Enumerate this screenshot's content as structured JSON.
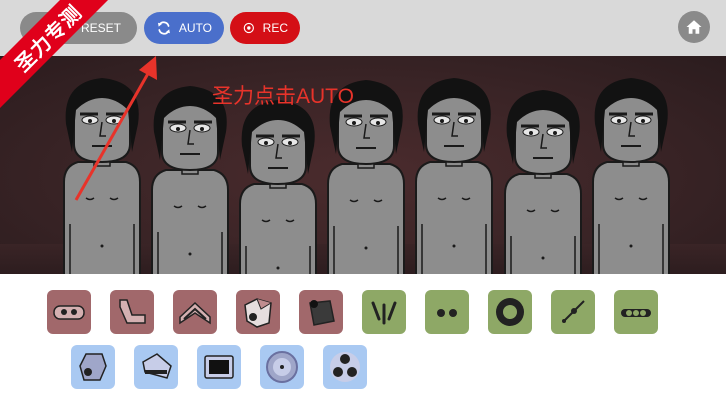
{
  "toolbar": {
    "reset_label": "RESET",
    "auto_label": "AUTO",
    "rec_label": "REC",
    "icons": {
      "reset": "reset-icon",
      "auto": "refresh-icon",
      "rec": "record-icon",
      "home": "home-icon"
    }
  },
  "overlay": {
    "ribbon_text": "圣力专测",
    "annotation_text": "圣力点击AUTO"
  },
  "stage": {
    "character_count": 7
  },
  "palette": {
    "row1": [
      {
        "group": "beats",
        "color": "#a1686b",
        "icon": "beat-pill-icon"
      },
      {
        "group": "beats",
        "color": "#a1686b",
        "icon": "beat-bent-pipe-icon"
      },
      {
        "group": "beats",
        "color": "#a1686b",
        "icon": "beat-chevron-icon"
      },
      {
        "group": "beats",
        "color": "#a1686b",
        "icon": "beat-shield-icon"
      },
      {
        "group": "beats",
        "color": "#a1686b",
        "icon": "beat-cube-icon"
      },
      {
        "group": "effects",
        "color": "#8ea866",
        "icon": "effect-tree-icon"
      },
      {
        "group": "effects",
        "color": "#8ea866",
        "icon": "effect-eyes-icon"
      },
      {
        "group": "effects",
        "color": "#8ea866",
        "icon": "effect-ring-icon"
      },
      {
        "group": "effects",
        "color": "#8ea866",
        "icon": "effect-antenna-icon"
      },
      {
        "group": "effects",
        "color": "#8ea866",
        "icon": "effect-dots-icon"
      }
    ],
    "row2": [
      {
        "group": "melodies",
        "color": "#a9c9f2",
        "icon": "melody-hexagon-icon"
      },
      {
        "group": "melodies",
        "color": "#a9c9f2",
        "icon": "melody-wedge-icon"
      },
      {
        "group": "melodies",
        "color": "#a9c9f2",
        "icon": "melody-screen-icon"
      },
      {
        "group": "melodies",
        "color": "#a9c9f2",
        "icon": "melody-disc-icon"
      },
      {
        "group": "melodies",
        "color": "#a9c9f2",
        "icon": "melody-three-dots-icon"
      }
    ]
  }
}
